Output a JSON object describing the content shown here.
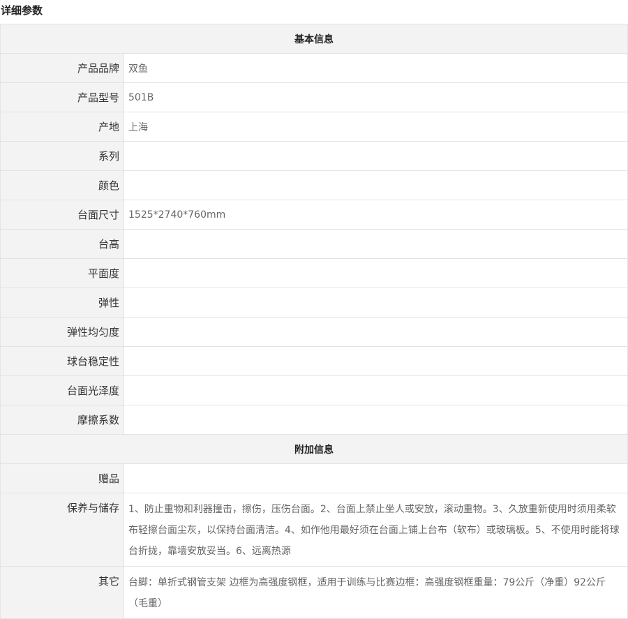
{
  "page": {
    "title": "详细参数"
  },
  "sections": [
    {
      "heading": "基本信息",
      "rows": [
        {
          "label": "产品品牌",
          "value": "双鱼"
        },
        {
          "label": "产品型号",
          "value": "501B"
        },
        {
          "label": "产地",
          "value": "上海"
        },
        {
          "label": "系列",
          "value": ""
        },
        {
          "label": "颜色",
          "value": ""
        },
        {
          "label": "台面尺寸",
          "value": "1525*2740*760mm"
        },
        {
          "label": "台高",
          "value": ""
        },
        {
          "label": "平面度",
          "value": ""
        },
        {
          "label": "弹性",
          "value": ""
        },
        {
          "label": "弹性均匀度",
          "value": ""
        },
        {
          "label": "球台稳定性",
          "value": ""
        },
        {
          "label": "台面光泽度",
          "value": ""
        },
        {
          "label": "摩擦系数",
          "value": ""
        }
      ]
    },
    {
      "heading": "附加信息",
      "rows": [
        {
          "label": "赠品",
          "value": ""
        },
        {
          "label": "保养与储存",
          "value": "1、防止重物和利器撞击，擦伤，压伤台面。2、台面上禁止坐人或安放，滚动重物。3、久放重新使用时须用柔软布轻擦台面尘灰，以保持台面清洁。4、如作他用最好须在台面上铺上台布（软布）或玻璃板。5、不使用时能将球台折拢，靠墙安放妥当。6、远离热源"
        },
        {
          "label": "其它",
          "value": "台脚：单折式钢管支架 边框为高强度钢框，适用于训练与比赛边框：高强度钢框重量：79公斤（净重）92公斤（毛重）"
        }
      ]
    }
  ]
}
